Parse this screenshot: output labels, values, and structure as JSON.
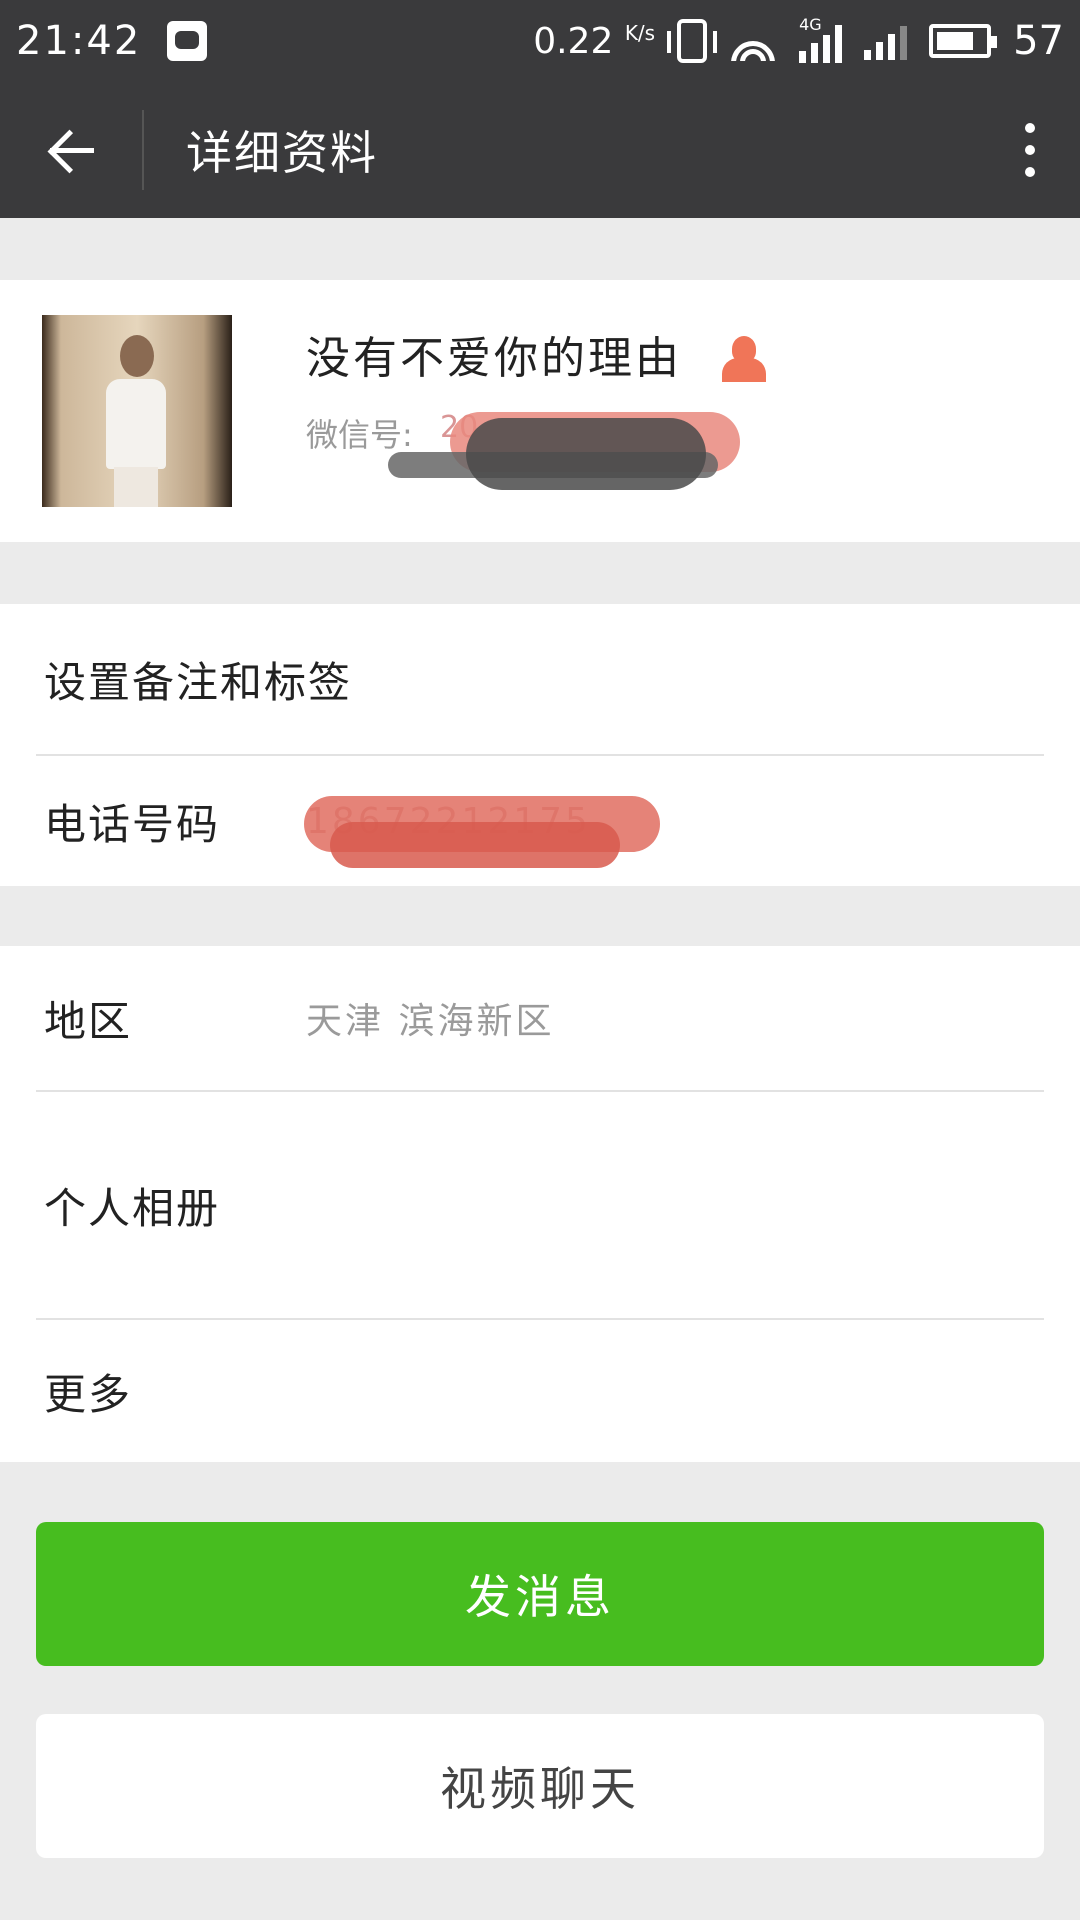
{
  "status_bar": {
    "time": "21:42",
    "speed": "0.22",
    "speed_unit": "K/s",
    "network": "4G",
    "battery": "57"
  },
  "header": {
    "title": "详细资料",
    "back_icon": "back-arrow-icon",
    "more_icon": "more-vertical-icon"
  },
  "profile": {
    "nickname": "没有不爱你的理由",
    "wechat_label": "微信号:",
    "wechat_id": "20",
    "gender_icon": "female-icon",
    "gender_color": "#f07558"
  },
  "rows": {
    "remark": "设置备注和标签",
    "phone_label": "电话号码",
    "phone_value": "18672212175",
    "region_label": "地区",
    "region_value": "天津  滨海新区",
    "album_label": "个人相册",
    "more_label": "更多"
  },
  "buttons": {
    "send_message": "发消息",
    "video_chat": "视频聊天"
  },
  "colors": {
    "header_bg": "#3a3a3c",
    "accent_green": "#47bd1f",
    "page_bg": "#ebebeb"
  }
}
